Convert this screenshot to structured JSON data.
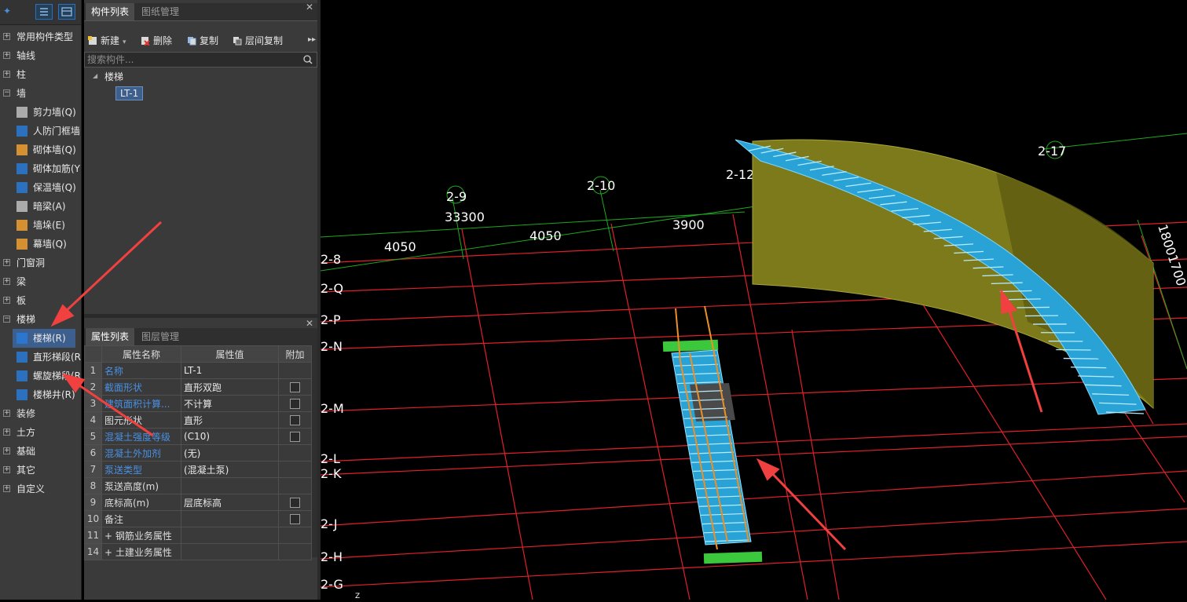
{
  "left_tree": {
    "categories": [
      {
        "label": "常用构件类型",
        "expanded": false
      },
      {
        "label": "轴线",
        "expanded": false
      },
      {
        "label": "柱",
        "expanded": false
      },
      {
        "label": "墙",
        "expanded": true
      },
      {
        "label": "门窗洞",
        "expanded": false
      },
      {
        "label": "梁",
        "expanded": false
      },
      {
        "label": "板",
        "expanded": false
      },
      {
        "label": "楼梯",
        "expanded": true
      },
      {
        "label": "装修",
        "expanded": false
      },
      {
        "label": "土方",
        "expanded": false
      },
      {
        "label": "基础",
        "expanded": false
      },
      {
        "label": "其它",
        "expanded": false
      },
      {
        "label": "自定义",
        "expanded": false
      }
    ],
    "wall_items": [
      "剪力墙(Q)",
      "人防门框墙",
      "砌体墙(Q)",
      "砌体加筋(Y",
      "保温墙(Q)",
      "暗梁(A)",
      "墙垛(E)",
      "幕墙(Q)"
    ],
    "stair_items": [
      "楼梯(R)",
      "直形梯段(R",
      "螺旋梯段(R",
      "楼梯井(R)"
    ],
    "selected": "楼梯(R)"
  },
  "component_panel": {
    "tabs": [
      "构件列表",
      "图纸管理"
    ],
    "active_tab": "构件列表",
    "toolbar": {
      "new": "新建",
      "delete": "删除",
      "copy": "复制",
      "floor_copy": "层间复制"
    },
    "search_placeholder": "搜索构件...",
    "tree_root": "楼梯",
    "items": [
      "LT-1"
    ]
  },
  "property_panel": {
    "tabs": [
      "属性列表",
      "图层管理"
    ],
    "active_tab": "属性列表",
    "headers": {
      "name": "属性名称",
      "value": "属性值",
      "extra": "附加"
    },
    "rows": [
      {
        "no": "1",
        "name": "名称",
        "value": "LT-1",
        "link": true,
        "checkbox": false
      },
      {
        "no": "2",
        "name": "截面形状",
        "value": "直形双跑",
        "link": true,
        "checkbox": true
      },
      {
        "no": "3",
        "name": "建筑面积计算...",
        "value": "不计算",
        "link": true,
        "checkbox": true
      },
      {
        "no": "4",
        "name": "图元形状",
        "value": "直形",
        "link": false,
        "checkbox": true
      },
      {
        "no": "5",
        "name": "混凝土强度等级",
        "value": "(C10)",
        "link": true,
        "checkbox": true
      },
      {
        "no": "6",
        "name": "混凝土外加剂",
        "value": "(无)",
        "link": true,
        "checkbox": false
      },
      {
        "no": "7",
        "name": "泵送类型",
        "value": "(混凝土泵)",
        "link": true,
        "checkbox": false
      },
      {
        "no": "8",
        "name": "泵送高度(m)",
        "value": "",
        "link": false,
        "checkbox": false
      },
      {
        "no": "9",
        "name": "底标高(m)",
        "value": "层底标高",
        "link": false,
        "checkbox": true
      },
      {
        "no": "10",
        "name": "备注",
        "value": "",
        "link": false,
        "checkbox": true
      },
      {
        "no": "11",
        "name": "+ 钢筋业务属性",
        "value": "",
        "link": false,
        "checkbox": false
      },
      {
        "no": "14",
        "name": "+ 土建业务属性",
        "value": "",
        "link": false,
        "checkbox": false
      }
    ]
  },
  "viewport": {
    "axis_labels_top": [
      "2-9",
      "2-10",
      "2-12",
      "2-17"
    ],
    "dimensions": [
      "33300",
      "4050",
      "4050",
      "3900",
      "18001700"
    ],
    "axis_labels_left": [
      "2-8",
      "2-Q",
      "2-P",
      "2-N",
      "2-M",
      "2-L",
      "2-K",
      "2-J",
      "2-H",
      "2-G"
    ],
    "colors": {
      "grid_red": "#e0202a",
      "grid_green": "#1fa81f",
      "stair_blue": "#29a3d6",
      "wall_olive": "#7c7a1a",
      "arrow_red": "#f04040",
      "landing_green": "#3cc83c",
      "rail_orange": "#e8902a"
    }
  }
}
